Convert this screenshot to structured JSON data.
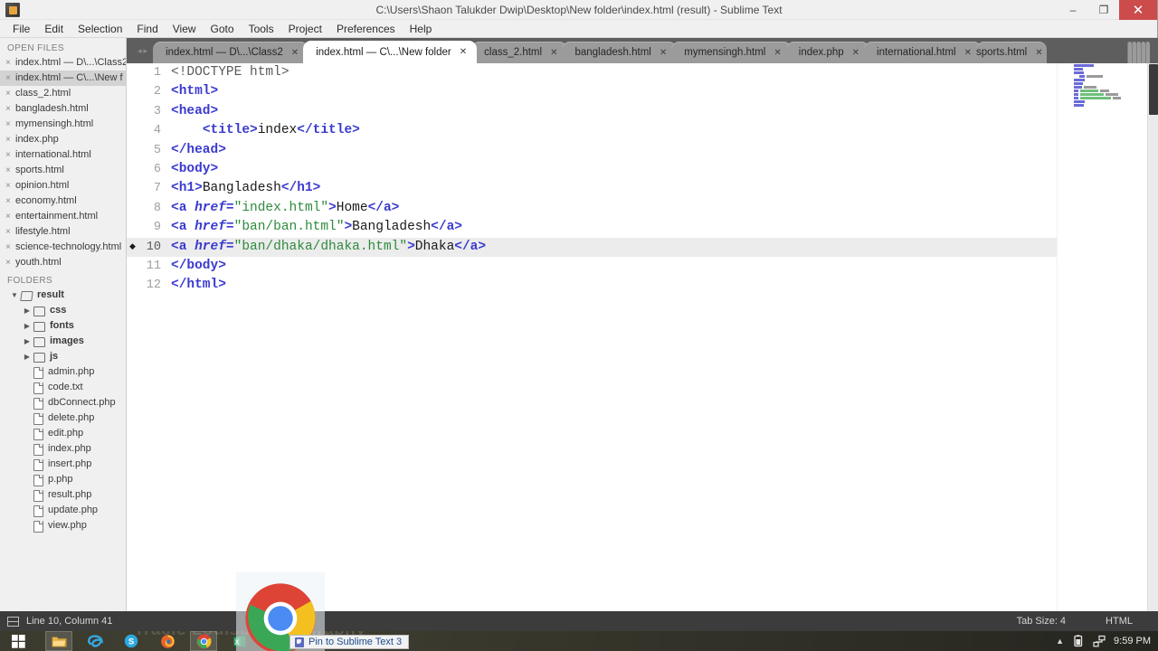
{
  "window": {
    "title": "C:\\Users\\Shaon Talukder Dwip\\Desktop\\New folder\\index.html (result) - Sublime Text",
    "minimize_label": "–",
    "maximize_label": "❐",
    "close_label": "✕"
  },
  "menubar": {
    "items": [
      "File",
      "Edit",
      "Selection",
      "Find",
      "View",
      "Goto",
      "Tools",
      "Project",
      "Preferences",
      "Help"
    ]
  },
  "sidebar": {
    "open_files_heading": "OPEN FILES",
    "folders_heading": "FOLDERS",
    "close_glyph": "×",
    "open_files": [
      {
        "label": "index.html — D\\...\\Class2",
        "active": false
      },
      {
        "label": "index.html — C\\...\\New f",
        "active": true
      },
      {
        "label": "class_2.html",
        "active": false
      },
      {
        "label": "bangladesh.html",
        "active": false
      },
      {
        "label": "mymensingh.html",
        "active": false
      },
      {
        "label": "index.php",
        "active": false
      },
      {
        "label": "international.html",
        "active": false
      },
      {
        "label": "sports.html",
        "active": false
      },
      {
        "label": "opinion.html",
        "active": false
      },
      {
        "label": "economy.html",
        "active": false
      },
      {
        "label": "entertainment.html",
        "active": false
      },
      {
        "label": "lifestyle.html",
        "active": false
      },
      {
        "label": "science-technology.html",
        "active": false
      },
      {
        "label": "youth.html",
        "active": false
      }
    ],
    "tree": [
      {
        "label": "result",
        "type": "folder",
        "expanded": true,
        "depth": 0
      },
      {
        "label": "css",
        "type": "folder",
        "expanded": false,
        "depth": 1
      },
      {
        "label": "fonts",
        "type": "folder",
        "expanded": false,
        "depth": 1
      },
      {
        "label": "images",
        "type": "folder",
        "expanded": false,
        "depth": 1
      },
      {
        "label": "js",
        "type": "folder",
        "expanded": false,
        "depth": 1
      },
      {
        "label": "admin.php",
        "type": "file",
        "depth": 1
      },
      {
        "label": "code.txt",
        "type": "file",
        "depth": 1
      },
      {
        "label": "dbConnect.php",
        "type": "file",
        "depth": 1
      },
      {
        "label": "delete.php",
        "type": "file",
        "depth": 1
      },
      {
        "label": "edit.php",
        "type": "file",
        "depth": 1
      },
      {
        "label": "index.php",
        "type": "file",
        "depth": 1
      },
      {
        "label": "insert.php",
        "type": "file",
        "depth": 1
      },
      {
        "label": "p.php",
        "type": "file",
        "depth": 1
      },
      {
        "label": "result.php",
        "type": "file",
        "depth": 1
      },
      {
        "label": "update.php",
        "type": "file",
        "depth": 1
      },
      {
        "label": "view.php",
        "type": "file",
        "depth": 1
      }
    ]
  },
  "tabs": {
    "nav_prev": "◂",
    "nav_next": "▸",
    "close_glyph": "✕",
    "items": [
      {
        "label": "index.html — D\\...\\Class2",
        "active": false
      },
      {
        "label": "index.html — C\\...\\New folder",
        "active": true
      },
      {
        "label": "class_2.html",
        "active": false
      },
      {
        "label": "bangladesh.html",
        "active": false
      },
      {
        "label": "mymensingh.html",
        "active": false
      },
      {
        "label": "index.php",
        "active": false
      },
      {
        "label": "international.html",
        "active": false
      },
      {
        "label": "sports.html",
        "active": false
      }
    ]
  },
  "editor": {
    "line_numbers": [
      "1",
      "2",
      "3",
      "4",
      "5",
      "6",
      "7",
      "8",
      "9",
      "10",
      "11",
      "12"
    ],
    "current_line": 10,
    "lines": [
      "<!DOCTYPE html>",
      "<html>",
      "<head>",
      "    <title>index</title>",
      "</head>",
      "<body>",
      "<h1>Bangladesh</h1>",
      "<a href=\"index.html\">Home</a>",
      "<a href=\"ban/ban.html\">Bangladesh</a>",
      "<a href=\"ban/dhaka/dhaka.html\">Dhaka</a>",
      "</body>",
      "</html>"
    ]
  },
  "statusbar": {
    "cursor_position": "Line 10, Column 41",
    "tab_size": "Tab Size: 4",
    "syntax": "HTML"
  },
  "taskbar": {
    "clock": "9:59 PM",
    "tooltip": "Pin to Sublime Text 3",
    "icons": [
      "start-icon",
      "file-explorer-icon",
      "internet-explorer-icon",
      "skype-icon",
      "firefox-icon",
      "chrome-icon",
      "excel-icon"
    ]
  },
  "desktop": {
    "wallpaper_text": "Tracie Louise Photography"
  },
  "colors": {
    "tag": "#3a3ad0",
    "string": "#2e8b3d",
    "text": "#1a1a1a",
    "close_button": "#cc4b4b",
    "statusbar_bg": "#3c3c3c",
    "tabbar_bg": "#5e5e5e"
  }
}
